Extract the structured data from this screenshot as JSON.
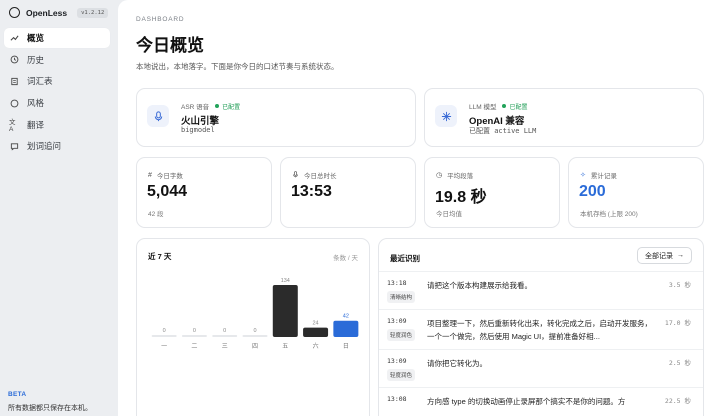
{
  "app": {
    "name": "OpenLess",
    "version": "v1.2.12"
  },
  "nav": [
    {
      "label": "概览",
      "icon": "trend-icon"
    },
    {
      "label": "历史",
      "icon": "history-icon"
    },
    {
      "label": "词汇表",
      "icon": "book-icon"
    },
    {
      "label": "风格",
      "icon": "palette-icon"
    },
    {
      "label": "翻译",
      "icon": "translate-icon"
    },
    {
      "label": "划词追问",
      "icon": "chat-icon"
    }
  ],
  "footer": {
    "badge": "BETA",
    "note": "所有数据都只保存在本机。"
  },
  "header": {
    "crumb": "DASHBOARD",
    "title": "今日概览",
    "subtitle": "本地说出，本地落字。下面是你今日的口述节奏与系统状态。"
  },
  "services": [
    {
      "kind": "ASR 语音",
      "status": "已配置",
      "name": "火山引擎",
      "sub": "bigmodel",
      "icon": "mic-icon"
    },
    {
      "kind": "LLM 模型",
      "status": "已配置",
      "name": "OpenAI 兼容",
      "sub": "已配置 active LLM",
      "icon": "sparkle-icon"
    }
  ],
  "stats": [
    {
      "label": "今日字数",
      "icon": "hash-icon",
      "glyph": "#",
      "value": "5,044",
      "note": "42 段"
    },
    {
      "label": "今日总时长",
      "icon": "mic-icon",
      "glyph": "🎙",
      "value": "13:53",
      "note": ""
    },
    {
      "label": "平均段落",
      "icon": "clock-icon",
      "glyph": "◷",
      "value": "19.8 秒",
      "note": "今日均值"
    },
    {
      "label": "累计记录",
      "icon": "sparkle-icon",
      "glyph": "✧",
      "value": "200",
      "note": "本机存档 (上限 200)"
    }
  ],
  "week_panel": {
    "title": "近 7 天",
    "unit": "条数 / 天"
  },
  "chart_data": {
    "type": "bar",
    "categories": [
      "一",
      "二",
      "三",
      "四",
      "五",
      "六",
      "日"
    ],
    "values": [
      0,
      0,
      0,
      0,
      134,
      24,
      42
    ],
    "highlight_index": 6,
    "colors": {
      "bar": "#2b2b2b",
      "highlight": "#2a6bd8",
      "empty": "#e6e8eb"
    }
  },
  "recent": {
    "title": "最近识别",
    "all_label": "全部记录",
    "items": [
      {
        "time": "13:18",
        "tag": "清晰结构",
        "text": "请把这个版本构建展示给我看。",
        "dur": "3.5 秒"
      },
      {
        "time": "13:09",
        "tag": "轻度润色",
        "text": "项目整理一下，然后重新转化出来，转化完成之后，启动开发服务，一个一个做完，然后使用 Magic UI，提前准备好相...",
        "dur": "17.0 秒"
      },
      {
        "time": "13:09",
        "tag": "轻度润色",
        "text": "请你把它转化为。",
        "dur": "2.5 秒"
      },
      {
        "time": "13:08",
        "tag": "",
        "text": "方向感 type 的切换动画停止录屏那个搞实不是你的问题。方",
        "dur": "22.5 秒"
      }
    ]
  }
}
